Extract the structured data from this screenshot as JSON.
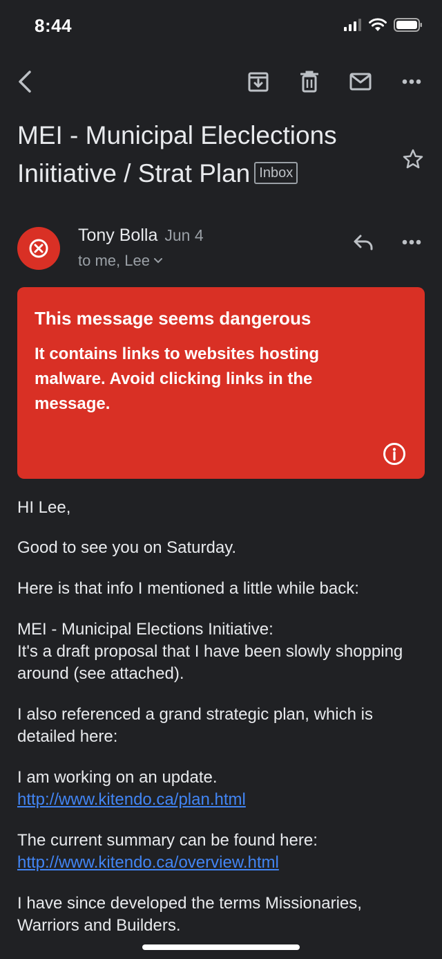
{
  "status": {
    "time": "8:44"
  },
  "toolbar": {
    "back_icon": "chevron-left-icon",
    "archive_icon": "archive-icon",
    "delete_icon": "trash-icon",
    "mark_unread_icon": "mail-icon",
    "more_icon": "more-horizontal-icon"
  },
  "email": {
    "subject": "MEI - Municipal Eleclections Iniitiative / Strat Plan",
    "label": "Inbox",
    "sender": "Tony Bolla",
    "date": "Jun 4",
    "recipients": "to me, Lee"
  },
  "warning": {
    "title": "This message seems dangerous",
    "body": "It contains links to websites hosting malware. Avoid clicking links in the message.",
    "color": "#d93025"
  },
  "body": {
    "greeting": "HI Lee,",
    "line1": "Good to see you on Saturday.",
    "line2": "Here is that info I mentioned a little while back:",
    "line3a": "MEI - Municipal Elections Initiative:",
    "line3b": "It's a draft proposal that I have been slowly shopping around (see attached).",
    "line4": "I also referenced a grand strategic plan, which is detailed here:",
    "line5": "I am working on an update.",
    "link1": "http://www.kitendo.ca/plan.html",
    "line6": "The current summary can be found here:",
    "link2": "http://www.kitendo.ca/overview.html",
    "line7": "I have since developed the terms Missionaries, Warriors and Builders."
  },
  "colors": {
    "background": "#202124",
    "link": "#4285f4",
    "danger": "#d93025"
  }
}
